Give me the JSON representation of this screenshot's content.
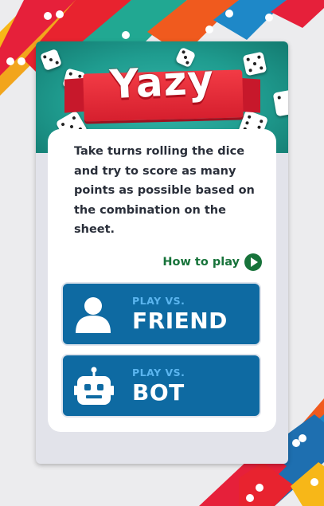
{
  "game": {
    "title": "Yazy",
    "description": "Take turns rolling the dice and try to score as many points as possible based on the combination on the sheet.",
    "how_to_play_label": "How to play"
  },
  "modes": [
    {
      "prefix": "PLAY VS.",
      "label": "FRIEND",
      "icon": "person-icon"
    },
    {
      "prefix": "PLAY VS.",
      "label": "BOT",
      "icon": "robot-icon"
    }
  ],
  "colors": {
    "button_blue": "#0e6aa2",
    "button_prefix": "#5bb5ef",
    "how_to_play_green": "#17733a",
    "banner_teal": "#1f9c8f",
    "ribbon_red": "#e02a36"
  }
}
